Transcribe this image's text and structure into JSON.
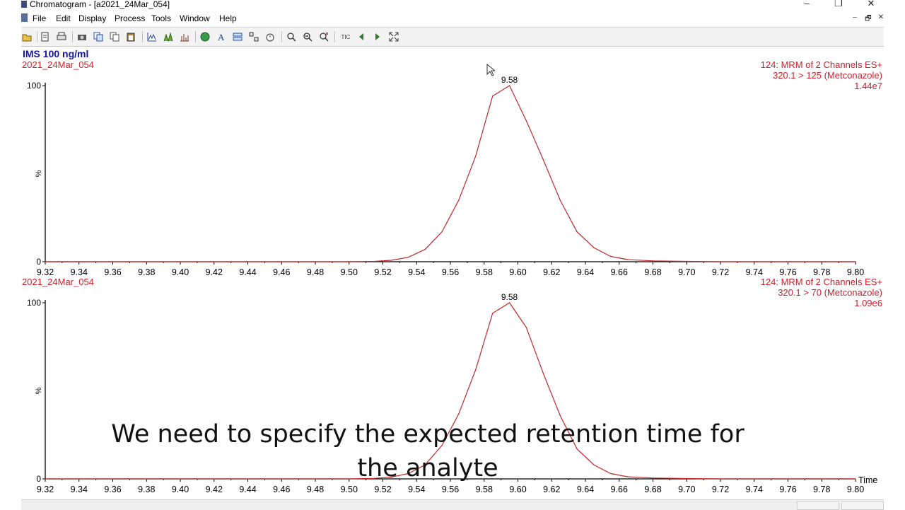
{
  "window": {
    "title": "Chromatogram - [a2021_24Mar_054]"
  },
  "window_controls": {
    "minimize": "–",
    "restore": "❐",
    "close": "✕",
    "mdi_minimize": "–",
    "mdi_restore": "🗗",
    "mdi_close": "✕"
  },
  "menu": {
    "items": [
      "File",
      "Edit",
      "Display",
      "Process",
      "Tools",
      "Window",
      "Help"
    ]
  },
  "toolbar": {
    "tic_label": "TIC"
  },
  "colors": {
    "trace": "#c0282c",
    "label_red": "#cc1f2a",
    "sample_blue": "#1515a0",
    "axis": "#000000"
  },
  "sample_name": "IMS 100 ng/ml",
  "chart_data": [
    {
      "type": "line",
      "file_label": "2021_24Mar_054",
      "channel_line1": "124: MRM of 2 Channels ES+",
      "channel_line2": "320.1 > 125 (Metconazole)",
      "intensity": "1.44e7",
      "peak_label": "9.58",
      "y_tick_top": "100",
      "y_tick_mid": "%",
      "y_tick_bottom": "0",
      "xlabel": "",
      "xlim": [
        9.32,
        9.8
      ],
      "ylim": [
        0,
        100
      ],
      "x_ticks": [
        "9.32",
        "9.34",
        "9.36",
        "9.38",
        "9.40",
        "9.42",
        "9.44",
        "9.46",
        "9.48",
        "9.50",
        "9.52",
        "9.54",
        "9.56",
        "9.58",
        "9.60",
        "9.62",
        "9.64",
        "9.66",
        "9.68",
        "9.70",
        "9.72",
        "9.74",
        "9.76",
        "9.78",
        "9.80"
      ],
      "x": [
        9.32,
        9.5,
        9.515,
        9.525,
        9.535,
        9.545,
        9.555,
        9.565,
        9.575,
        9.585,
        9.595,
        9.605,
        9.615,
        9.625,
        9.635,
        9.645,
        9.655,
        9.665,
        9.68,
        9.7,
        9.72,
        9.8
      ],
      "y": [
        0,
        0,
        0.2,
        0.8,
        2.5,
        7,
        17,
        35,
        60,
        94,
        100,
        80,
        58,
        35,
        17,
        8,
        3,
        1.2,
        0.5,
        0.2,
        0,
        0
      ]
    },
    {
      "type": "line",
      "file_label": "2021_24Mar_054",
      "channel_line1": "124: MRM of 2 Channels ES+",
      "channel_line2": "320.1 > 70 (Metconazole)",
      "intensity": "1.09e6",
      "peak_label": "9.58",
      "y_tick_top": "100",
      "y_tick_mid": "%",
      "y_tick_bottom": "0",
      "xlabel": "Time",
      "xlim": [
        9.32,
        9.8
      ],
      "ylim": [
        0,
        100
      ],
      "x_ticks": [
        "9.32",
        "9.34",
        "9.36",
        "9.38",
        "9.40",
        "9.42",
        "9.44",
        "9.46",
        "9.48",
        "9.50",
        "9.52",
        "9.54",
        "9.56",
        "9.58",
        "9.60",
        "9.62",
        "9.64",
        "9.66",
        "9.68",
        "9.70",
        "9.72",
        "9.74",
        "9.76",
        "9.78",
        "9.80"
      ],
      "x": [
        9.32,
        9.5,
        9.515,
        9.525,
        9.535,
        9.545,
        9.555,
        9.565,
        9.575,
        9.585,
        9.595,
        9.605,
        9.615,
        9.625,
        9.635,
        9.645,
        9.655,
        9.665,
        9.68,
        9.7,
        9.72,
        9.8
      ],
      "y": [
        0,
        0,
        0.3,
        1,
        3,
        8,
        19,
        37,
        62,
        94,
        100,
        86,
        60,
        36,
        17,
        8,
        3,
        1.2,
        0.5,
        0.2,
        0,
        0
      ]
    }
  ],
  "subtitle": {
    "line1": "We need to specify the expected retention time for",
    "line2": "the analyte"
  }
}
